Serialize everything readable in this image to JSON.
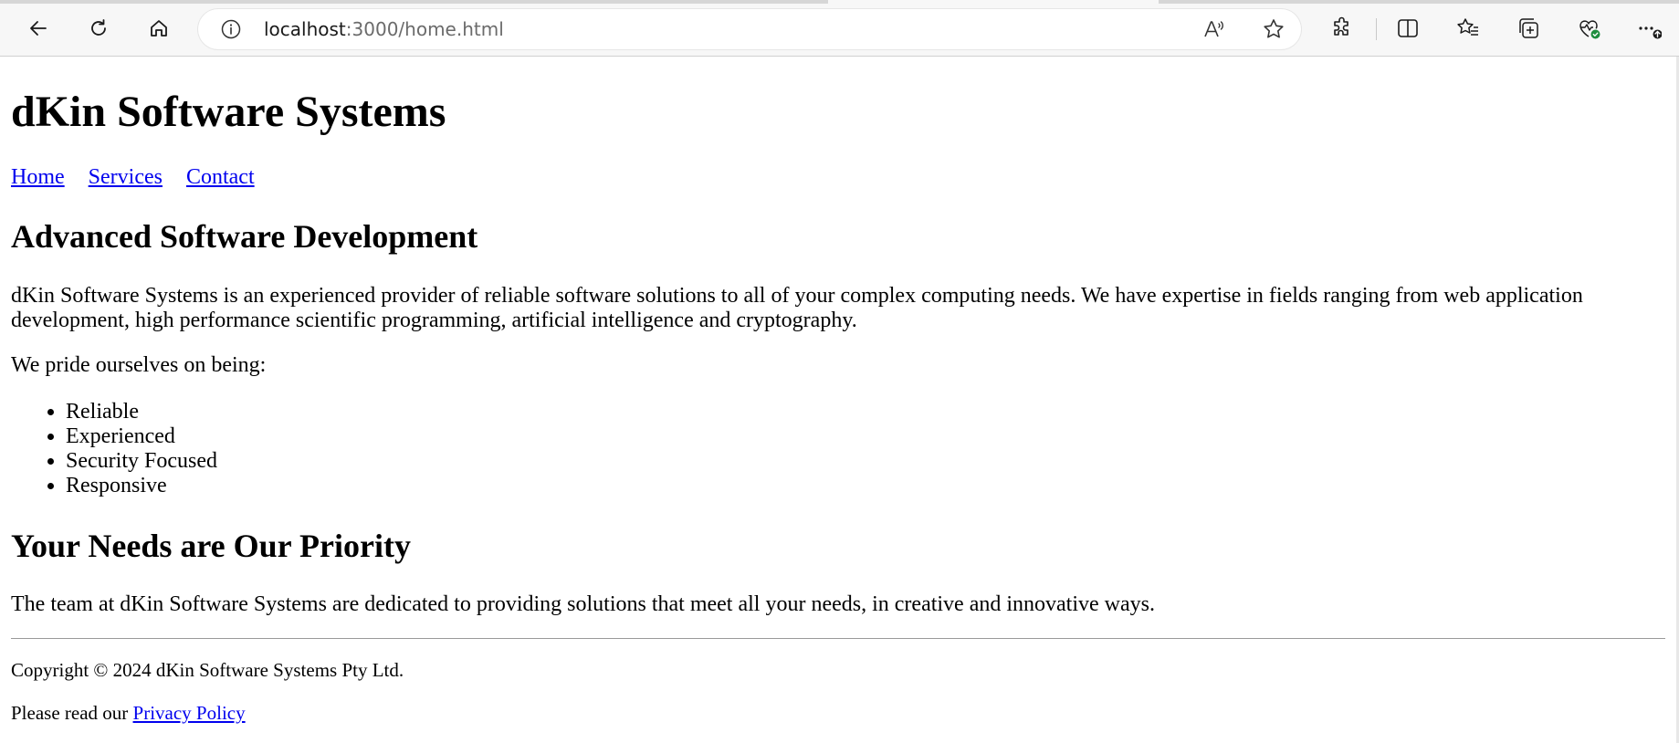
{
  "browser": {
    "url_host": "localhost",
    "url_rest": ":3000/home.html",
    "icons": [
      "back-icon",
      "refresh-icon",
      "home-icon",
      "site-info-icon",
      "read-aloud-icon",
      "favorite-star-icon",
      "extensions-icon",
      "split-screen-icon",
      "favorites-icon",
      "collections-icon",
      "browser-essentials-icon",
      "more-menu-icon"
    ]
  },
  "site": {
    "title": "dKin Software Systems"
  },
  "nav": {
    "home": "Home",
    "services": "Services",
    "contact": "Contact"
  },
  "section1": {
    "heading": "Advanced Software Development",
    "intro": "dKin Software Systems is an experienced provider of reliable software solutions to all of your complex computing needs. We have expertise in fields ranging from web application development, high performance scientific programming, artificial intelligence and cryptography.",
    "pride": "We pride ourselves on being:",
    "qualities": [
      "Reliable",
      "Experienced",
      "Security Focused",
      "Responsive"
    ]
  },
  "section2": {
    "heading": "Your Needs are Our Priority",
    "body": "The team at dKin Software Systems are dedicated to providing solutions that meet all your needs, in creative and innovative ways."
  },
  "footer": {
    "copyright": "Copyright © 2024 dKin Software Systems Pty Ltd.",
    "privacy_prefix": "Please read our ",
    "privacy_link": "Privacy Policy"
  },
  "colors": {
    "link": "#0000ee",
    "chrome_bg": "#f7f7f7",
    "badge_green": "#1e8e3e"
  }
}
